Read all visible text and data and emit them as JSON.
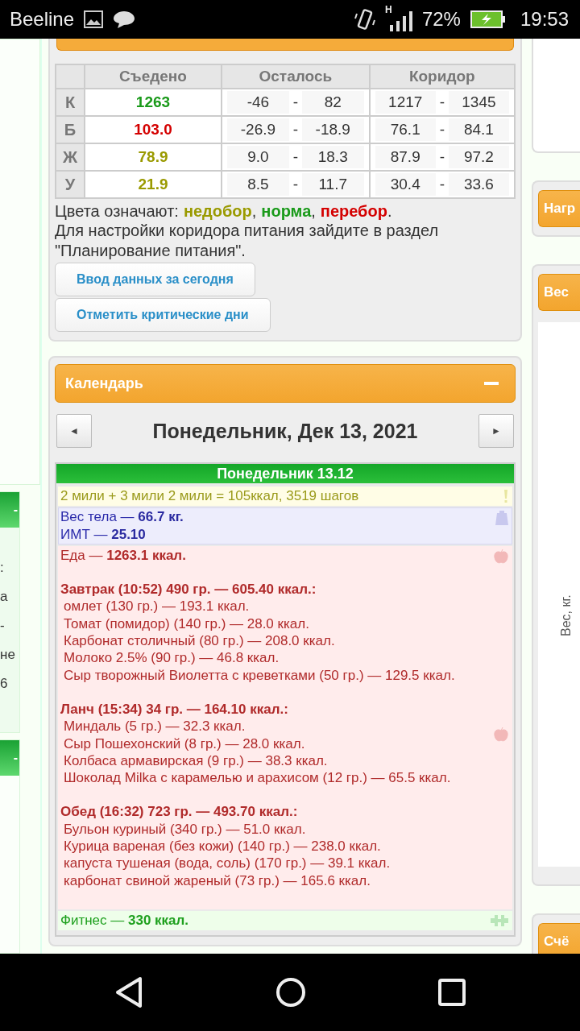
{
  "status_bar": {
    "carrier": "Beeline",
    "network": "H",
    "battery": "72%",
    "time": "19:53"
  },
  "left_column": {
    "panels": [
      {
        "header": "-",
        "lines": [
          ":",
          "а",
          "-",
          "не",
          "6"
        ]
      },
      {
        "header": "-"
      }
    ]
  },
  "nutrition": {
    "columns": [
      "Съедено",
      "Осталось",
      "Коридор"
    ],
    "rows": [
      {
        "nutrient": "К",
        "eaten": "1263",
        "color": "#1a9a1a",
        "left_min": "-46",
        "left_sep": "-",
        "left_max": "82",
        "range_min": "1217",
        "range_sep": "-",
        "range_max": "1345"
      },
      {
        "nutrient": "Б",
        "eaten": "103.0",
        "color": "#d40000",
        "left_min": "-26.9",
        "left_sep": "-",
        "left_max": "-18.9",
        "range_min": "76.1",
        "range_sep": "-",
        "range_max": "84.1"
      },
      {
        "nutrient": "Ж",
        "eaten": "78.9",
        "color": "#9a9a00",
        "left_min": "9.0",
        "left_sep": "-",
        "left_max": "18.3",
        "range_min": "87.9",
        "range_sep": "-",
        "range_max": "97.2"
      },
      {
        "nutrient": "У",
        "eaten": "21.9",
        "color": "#9a9a00",
        "left_min": "8.5",
        "left_sep": "-",
        "left_max": "11.7",
        "range_min": "30.4",
        "range_sep": "-",
        "range_max": "33.6"
      }
    ],
    "legend": {
      "label": "Цвета означают:",
      "items": [
        {
          "text": "недобор",
          "color": "#9a9a00",
          "after": ","
        },
        {
          "text": "норма",
          "color": "#1a9a1a",
          "after": ","
        },
        {
          "text": "перебор",
          "color": "#d40000",
          "after": "."
        }
      ]
    },
    "note": "Для настройки коридора питания зайдите в раздел \"Планирование питания\".",
    "buttons": [
      "Ввод данных за сегодня",
      "Отметить критические дни"
    ]
  },
  "calendar": {
    "title": "Календарь",
    "prev": "◄",
    "next": "►",
    "date": "Понедельник, Дек 13, 2021",
    "day": {
      "header": "Понедельник 13.12",
      "entries": [
        {
          "kind": "activity",
          "lines": [
            "2 мили + 3 мили 2 мили = 105ккал, 3519 шагов"
          ]
        },
        {
          "kind": "weight",
          "lines": [
            "Вес тела — **66.7 кг.**",
            "ИМТ — **25.10**"
          ]
        },
        {
          "kind": "food",
          "lines": [
            "Еда — **1263.1 ккал.**"
          ],
          "meals": [
            {
              "title": "Завтрак (10:52) 490 гр. — 605.40 ккал.:",
              "items": [
                "омлет (130 гр.) — 193.1 ккал.",
                "Томат (помидор) (140 гр.) — 28.0 ккал.",
                "Карбонат столичный (80 гр.) — 208.0 ккал.",
                "Молоко 2.5% (90 гр.) — 46.8 ккал.",
                "Сыр творожный Виолетта с креветками (50 гр.) — 129.5 ккал."
              ]
            },
            {
              "title": "Ланч (15:34) 34 гр. — 164.10 ккал.:",
              "items": [
                "Миндаль (5 гр.) — 32.3 ккал.",
                "Сыр Пошехонский (8 гр.) — 28.0 ккал.",
                "Колбаса армавирская (9 гр.) — 38.3 ккал.",
                "Шоколад Milka с карамелью и арахисом (12 гр.) — 65.5 ккал."
              ]
            },
            {
              "title": "Обед (16:32) 723 гр. — 493.70 ккал.:",
              "items": [
                "Бульон куриный (340 гр.) — 51.0 ккал.",
                "Курица вареная (без кожи) (140 гр.) — 238.0 ккал.",
                "капуста тушеная (вода, соль) (170 гр.) — 39.1 ккал.",
                "карбонат свиной жареный (73 гр.) — 165.6 ккал."
              ]
            }
          ]
        },
        {
          "kind": "fitness",
          "lines": [
            "Фитнес — **330 ккал.**"
          ]
        }
      ]
    }
  },
  "right_column": {
    "panels": [
      {
        "header": "Нагр"
      },
      {
        "header": "Вес",
        "axis_label": "Вес, кг."
      },
      {
        "header": "Счё"
      }
    ]
  }
}
